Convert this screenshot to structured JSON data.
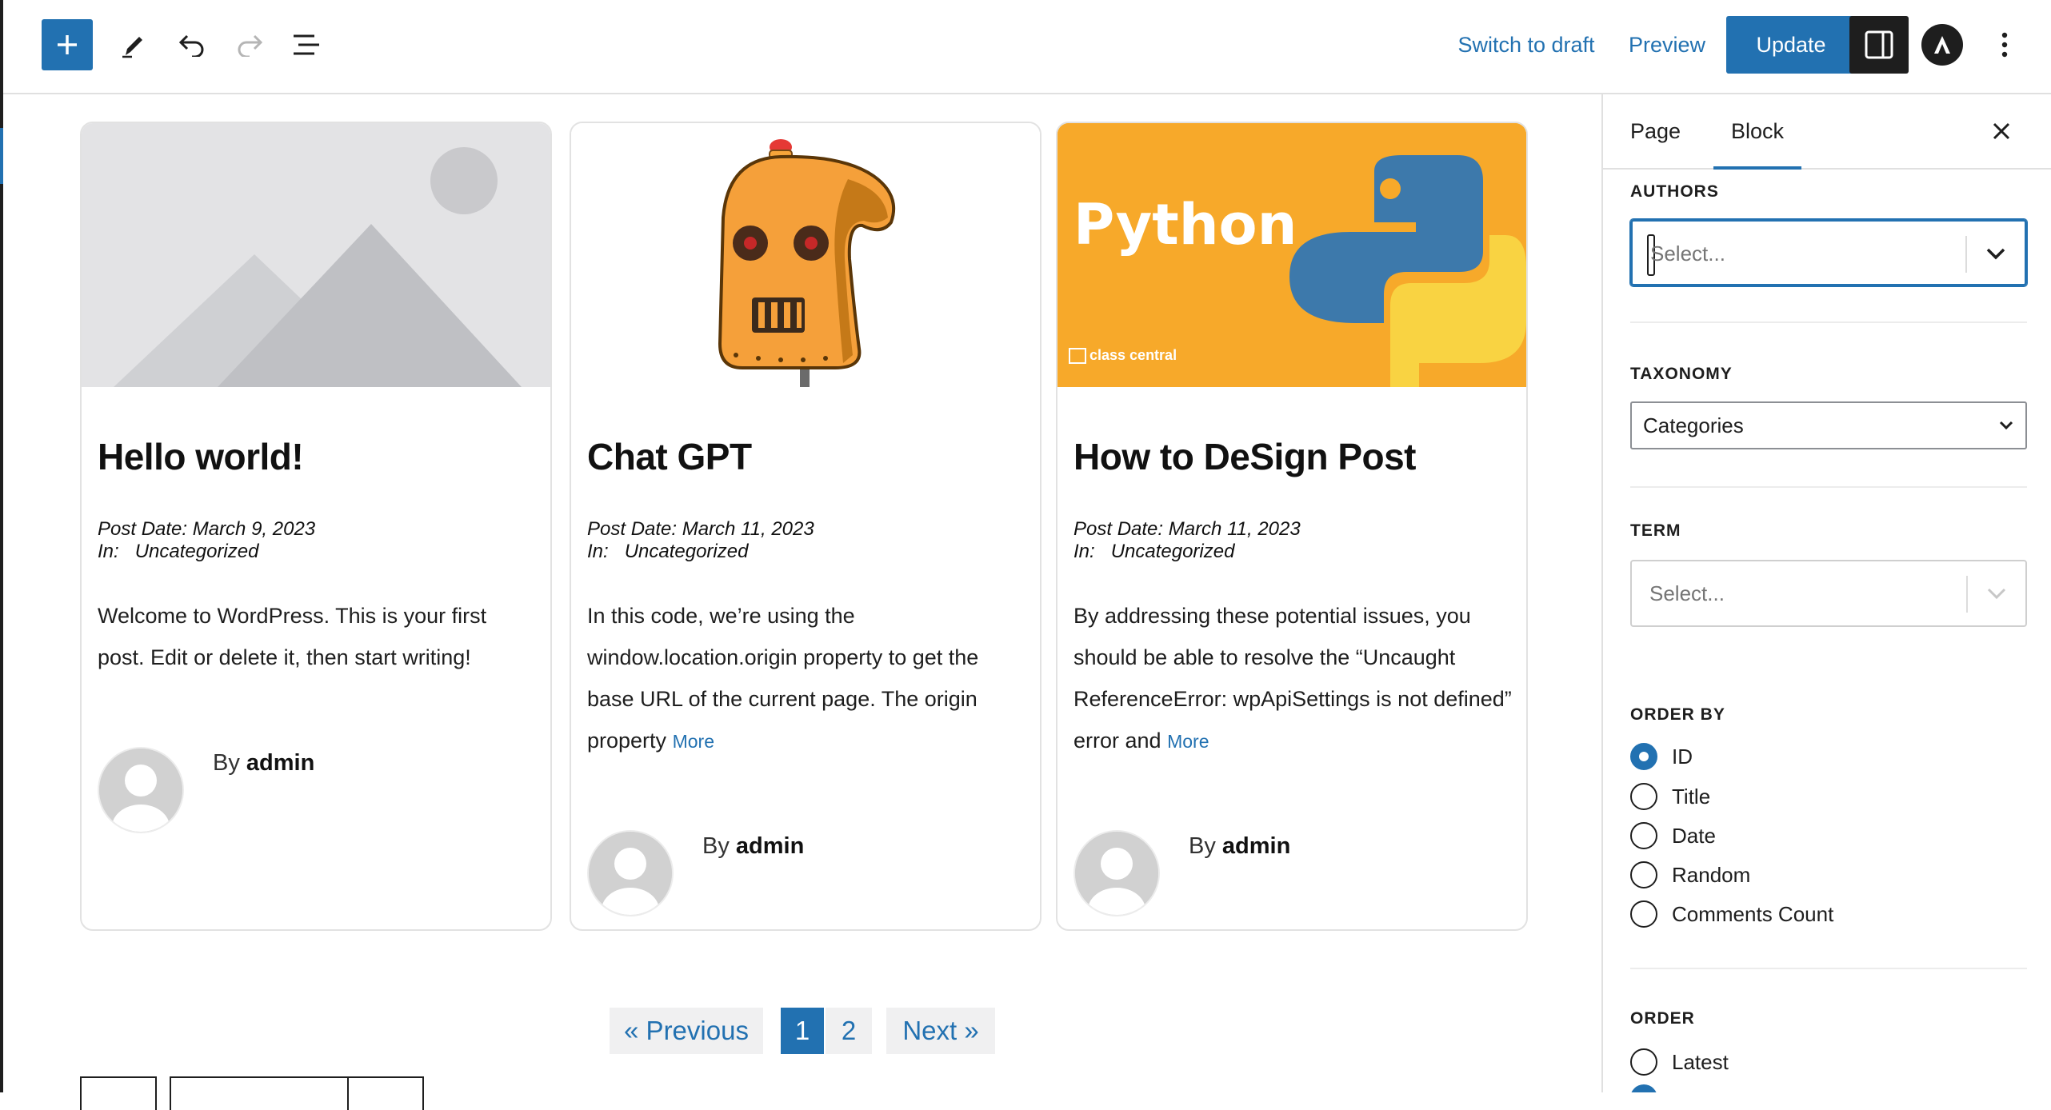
{
  "toolbar": {
    "add_icon": "plus-icon",
    "tools": [
      "pencil-icon",
      "undo-icon",
      "redo-icon",
      "list-view-icon"
    ],
    "switch_to_draft": "Switch to draft",
    "preview": "Preview",
    "update": "Update",
    "settings_icon": "sidebar-toggle-icon",
    "plugin_icon": "astra-icon",
    "options_icon": "kebab-menu-icon"
  },
  "posts": [
    {
      "title": "Hello world!",
      "date_line": "Post Date: March 9, 2023",
      "category_line": "In:   Uncategorized",
      "excerpt": "Welcome to WordPress. This is your first post. Edit or delete it, then start writing!",
      "more": "",
      "by": "By",
      "author": "admin",
      "image": "placeholder-image-icon"
    },
    {
      "title": "Chat GPT",
      "date_line": "Post Date: March 11, 2023",
      "category_line": "In:   Uncategorized",
      "excerpt": "In this code, we’re using the window.location.origin property to get the base URL of the current page. The origin property",
      "more": "More",
      "by": "By",
      "author": "admin",
      "image": "robot-head-illustration"
    },
    {
      "title": "How to DeSign Post",
      "date_line": "Post Date: March 11, 2023",
      "category_line": "In:   Uncategorized",
      "excerpt": "By addressing these potential issues, you should be able to resolve the “Uncaught ReferenceError: wpApiSettings is not defined” error and",
      "more": "More",
      "by": "By",
      "author": "admin",
      "image": "python-logo-banner",
      "image_text": "Python",
      "image_caption": "class central"
    }
  ],
  "pagination": {
    "previous": "« Previous",
    "pages": [
      "1",
      "2"
    ],
    "current": "1",
    "next": "Next »"
  },
  "sidebar": {
    "tabs": [
      "Page",
      "Block"
    ],
    "active_tab": "Block",
    "close_icon": "close-icon",
    "authors": {
      "label": "AUTHORS",
      "placeholder": "Select..."
    },
    "taxonomy": {
      "label": "TAXONOMY",
      "value": "Categories"
    },
    "term": {
      "label": "TERM",
      "placeholder": "Select..."
    },
    "order_by": {
      "label": "ORDER BY",
      "options": [
        "ID",
        "Title",
        "Date",
        "Random",
        "Comments Count"
      ],
      "selected": "ID"
    },
    "order": {
      "label": "ORDER",
      "options": [
        "Latest"
      ]
    }
  },
  "colors": {
    "accent": "#2271b1",
    "dark": "#1e1e1e",
    "python_bg": "#f9a825",
    "robot_orange": "#f39c2b"
  }
}
